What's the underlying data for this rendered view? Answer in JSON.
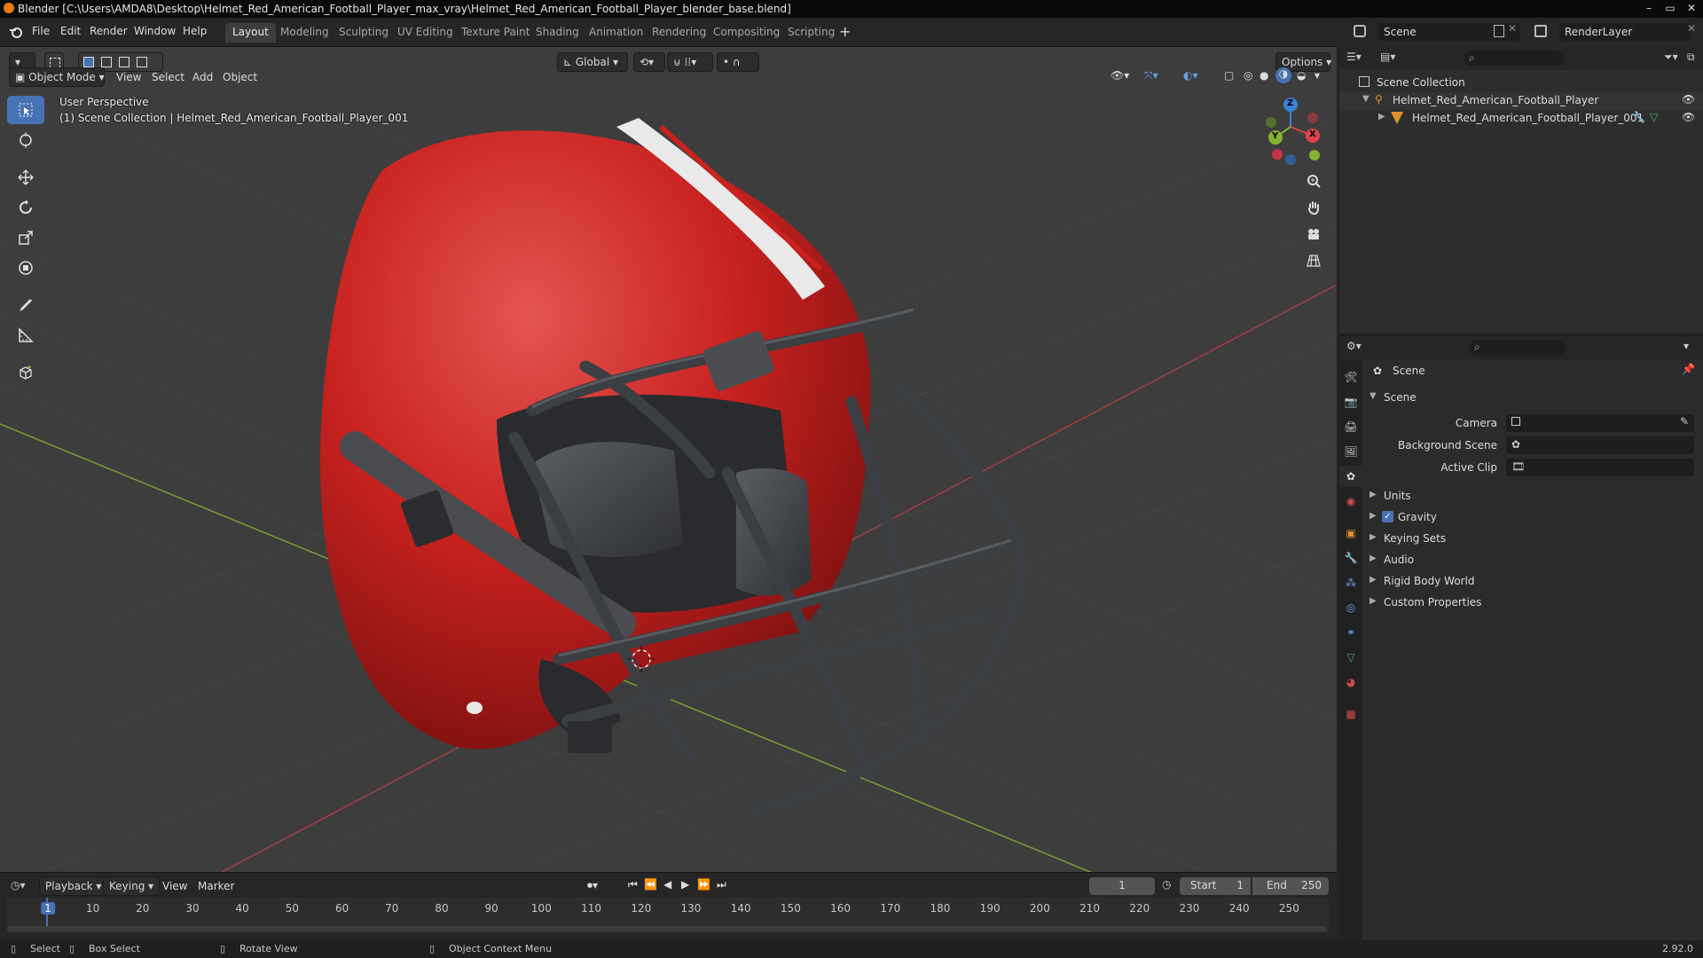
{
  "window": {
    "title": "Blender [C:\\Users\\AMDA8\\Desktop\\Helmet_Red_American_Football_Player_max_vray\\Helmet_Red_American_Football_Player_blender_base.blend]",
    "minimize": "–",
    "maximize": "▭",
    "close": "✕"
  },
  "menu": {
    "file": "File",
    "edit": "Edit",
    "render": "Render",
    "window": "Window",
    "help": "Help"
  },
  "workspaces": [
    "Layout",
    "Modeling",
    "Sculpting",
    "UV Editing",
    "Texture Paint",
    "Shading",
    "Animation",
    "Rendering",
    "Compositing",
    "Scripting"
  ],
  "workspace_add": "+",
  "top_right": {
    "scene_label": "Scene",
    "layer_label": "RenderLayer"
  },
  "viewport_header": {
    "orientation": "Global",
    "options": "Options",
    "mode": "Object Mode",
    "view": "View",
    "select": "Select",
    "add": "Add",
    "object": "Object"
  },
  "viewport_overlay": {
    "perspective": "User Perspective",
    "collection": "(1) Scene Collection | Helmet_Red_American_Football_Player_001"
  },
  "gizmo": {
    "x": "X",
    "y": "Y",
    "z": "Z"
  },
  "outliner": {
    "root": "Scene Collection",
    "collection": "Helmet_Red_American_Football_Player",
    "object": "Helmet_Red_American_Football_Player_001"
  },
  "properties": {
    "context": "Scene",
    "panel": "Scene",
    "camera_label": "Camera",
    "background_scene_label": "Background Scene",
    "active_clip_label": "Active Clip",
    "sections": [
      "Units",
      "Gravity",
      "Keying Sets",
      "Audio",
      "Rigid Body World",
      "Custom Properties"
    ],
    "gravity_checked": true
  },
  "timeline": {
    "playback": "Playback",
    "keying": "Keying",
    "view": "View",
    "marker": "Marker",
    "current_frame": "1",
    "start_label": "Start",
    "start": "1",
    "end_label": "End",
    "end": "250",
    "ticks": [
      "1",
      "10",
      "20",
      "30",
      "40",
      "50",
      "60",
      "70",
      "80",
      "90",
      "100",
      "110",
      "120",
      "130",
      "140",
      "150",
      "160",
      "170",
      "180",
      "190",
      "200",
      "210",
      "220",
      "230",
      "240",
      "250"
    ]
  },
  "status": {
    "select": "Select",
    "box_select": "Box Select",
    "rotate_view": "Rotate View",
    "context_menu": "Object Context Menu",
    "version": "2.92.0"
  },
  "colors": {
    "accent": "#4772b3",
    "helmet_red": "#c8221f",
    "x_axis": "#e0424a",
    "y_axis": "#86b22f",
    "z_axis": "#3b82d6"
  }
}
